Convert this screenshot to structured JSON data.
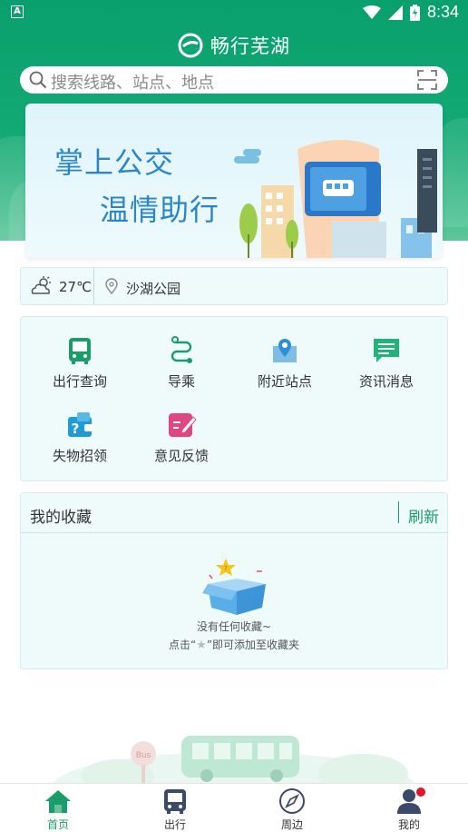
{
  "status_bar": {
    "left_glyph": "A",
    "time": "8:34"
  },
  "app": {
    "title": "畅行芜湖",
    "logo_icon": "app-logo-icon"
  },
  "search": {
    "placeholder": "搜索线路、站点、地点",
    "icon": "search-icon",
    "scan_icon": "scan-icon"
  },
  "banner": {
    "line1": "掌上公交",
    "line2": "温情助行"
  },
  "info": {
    "weather_icon": "partly-cloudy-icon",
    "temperature": "27℃",
    "location_icon": "location-pin-icon",
    "location": "沙湖公园"
  },
  "services": [
    {
      "label": "出行查询",
      "icon": "bus-icon",
      "color": "#1a9d6a"
    },
    {
      "label": "导乘",
      "icon": "route-icon",
      "color": "#1a9d6a"
    },
    {
      "label": "附近站点",
      "icon": "map-pin-icon",
      "color": "#2e8fd8"
    },
    {
      "label": "资讯消息",
      "icon": "message-icon",
      "color": "#20b37a"
    },
    {
      "label": "失物招领",
      "icon": "lost-found-icon",
      "color": "#1f9bd8"
    },
    {
      "label": "意见反馈",
      "icon": "feedback-icon",
      "color": "#e0467f"
    }
  ],
  "favorites": {
    "title": "我的收藏",
    "refresh": "刷新",
    "empty_line1": "没有任何收藏~",
    "empty_line2_prefix": "点击“",
    "empty_line2_star": "★",
    "empty_line2_suffix": "”即可添加至收藏夹"
  },
  "bottom_nav": [
    {
      "label": "首页",
      "icon": "home-icon",
      "active": true
    },
    {
      "label": "出行",
      "icon": "bus-icon",
      "active": false
    },
    {
      "label": "周边",
      "icon": "compass-icon",
      "active": false
    },
    {
      "label": "我的",
      "icon": "user-icon",
      "active": false,
      "badge": true
    }
  ],
  "colors": {
    "primary": "#1a9d6a",
    "card_bg": "#eefbfa",
    "badge": "#e5122c"
  }
}
